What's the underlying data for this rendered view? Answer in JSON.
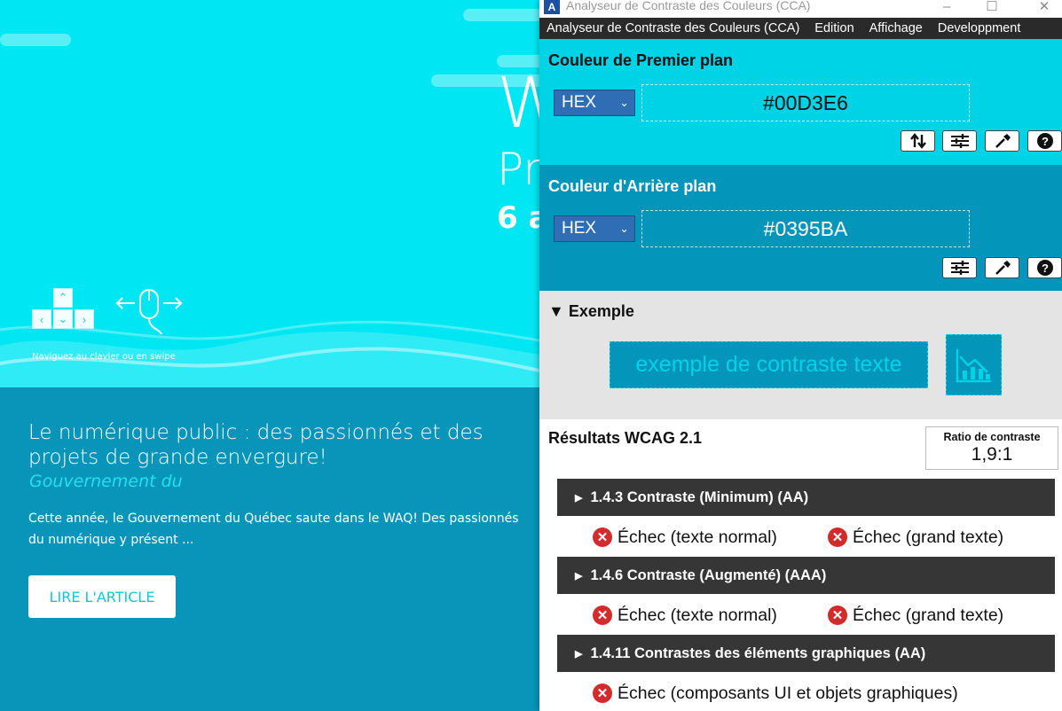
{
  "background_site": {
    "hero_letter_1": "W",
    "hero_letter_2": "Pr",
    "hero_date_fragment": "6 a",
    "nav_hint": "Naviguez au clavier ou en swipe",
    "article_title": "Le numérique public : des passionnés et des projets de grande envergure!",
    "article_subtitle": "Gouvernement du",
    "article_body": "Cette année, le Gouvernement du Québec saute dans le WAQ! Des passionnés du numérique y présent ...",
    "read_button": "LIRE L'ARTICLE"
  },
  "window": {
    "title": "Analyseur de Contraste des Couleurs (CCA)",
    "logo_text": "A",
    "minimize": "–",
    "maximize": "☐",
    "close": "✕"
  },
  "menu": [
    "Analyseur de Contraste des Couleurs (CCA)",
    "Edition",
    "Affichage",
    "Developpment"
  ],
  "foreground": {
    "title": "Couleur de Premier plan",
    "format": "HEX",
    "value": "#00D3E6",
    "color": "#00D3E6",
    "tools": [
      "swap-icon",
      "sliders-icon",
      "eyedropper-icon",
      "help-icon"
    ]
  },
  "background": {
    "title": "Couleur d'Arrière plan",
    "format": "HEX",
    "value": "#0395BA",
    "color": "#0395BA",
    "tools": [
      "sliders-icon",
      "eyedropper-icon",
      "help-icon"
    ]
  },
  "example": {
    "title": "Exemple",
    "sample_text": "exemple de contraste texte",
    "graphic_icon": "chart-icon"
  },
  "results": {
    "title": "Résultats WCAG 2.1",
    "ratio_label": "Ratio de contraste",
    "ratio_value": "1,9:1",
    "criteria": [
      {
        "label": "1.4.3 Contraste (Minimum) (AA)",
        "results": [
          "Échec (texte normal)",
          "Échec (grand texte)"
        ]
      },
      {
        "label": "1.4.6 Contraste (Augmenté) (AAA)",
        "results": [
          "Échec (texte normal)",
          "Échec (grand texte)"
        ]
      },
      {
        "label": "1.4.11 Contrastes des éléments graphiques (AA)",
        "results": [
          "Échec (composants UI et objets graphiques)"
        ]
      }
    ],
    "fail_color": "#D32B2B"
  }
}
